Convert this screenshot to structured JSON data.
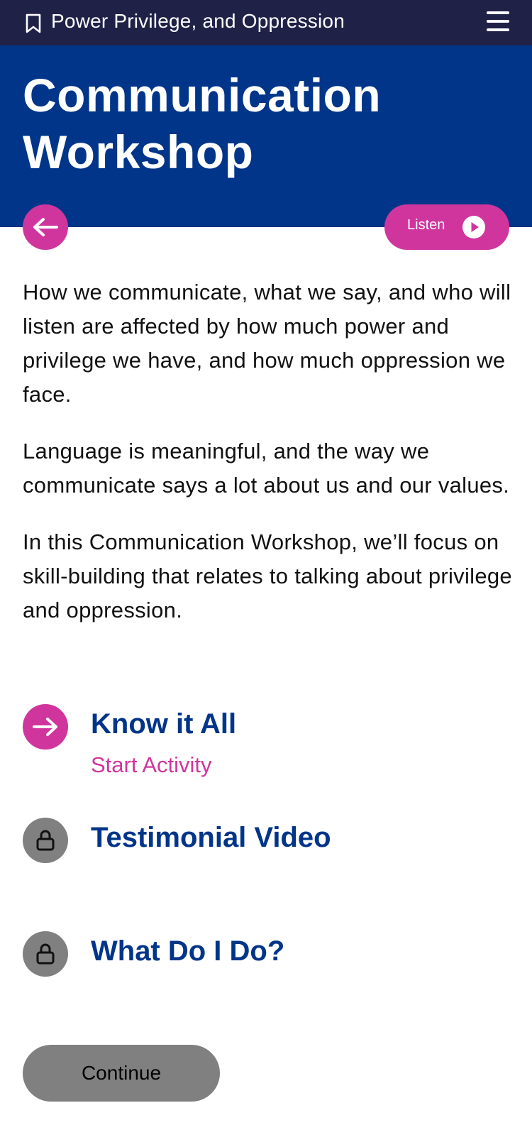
{
  "header": {
    "module_title": "Power Privilege, and Oppression",
    "bookmark_icon": "bookmark-icon",
    "menu_icon": "hamburger-menu-icon"
  },
  "hero": {
    "title_line1": "Communication",
    "title_line2": "Workshop"
  },
  "controls": {
    "back_icon": "arrow-left-icon",
    "listen_label": "Listen",
    "listen_icon": "play-icon"
  },
  "intro": {
    "paragraphs": [
      "How we communicate, what we say, and who will listen are affected by how much power and privilege we have, and how much oppression we face.",
      "Language is meaningful, and the way we communicate says a lot about us and our values.",
      "In this Communication Workshop, we’ll focus on skill-building that relates to talking about privilege and oppression."
    ]
  },
  "activities": [
    {
      "title": "Know it All",
      "action": "Start Activity",
      "status": "unlocked",
      "icon": "arrow-right-icon"
    },
    {
      "title": "Testimonial Video",
      "status": "locked",
      "icon": "lock-icon"
    },
    {
      "title": "What Do I Do?",
      "status": "locked",
      "icon": "lock-icon"
    }
  ],
  "footer": {
    "continue_label": "Continue"
  },
  "colors": {
    "topbar": "#1f2147",
    "hero": "#003589",
    "accent": "#d0359e",
    "heading": "#003589",
    "locked": "#808080"
  }
}
